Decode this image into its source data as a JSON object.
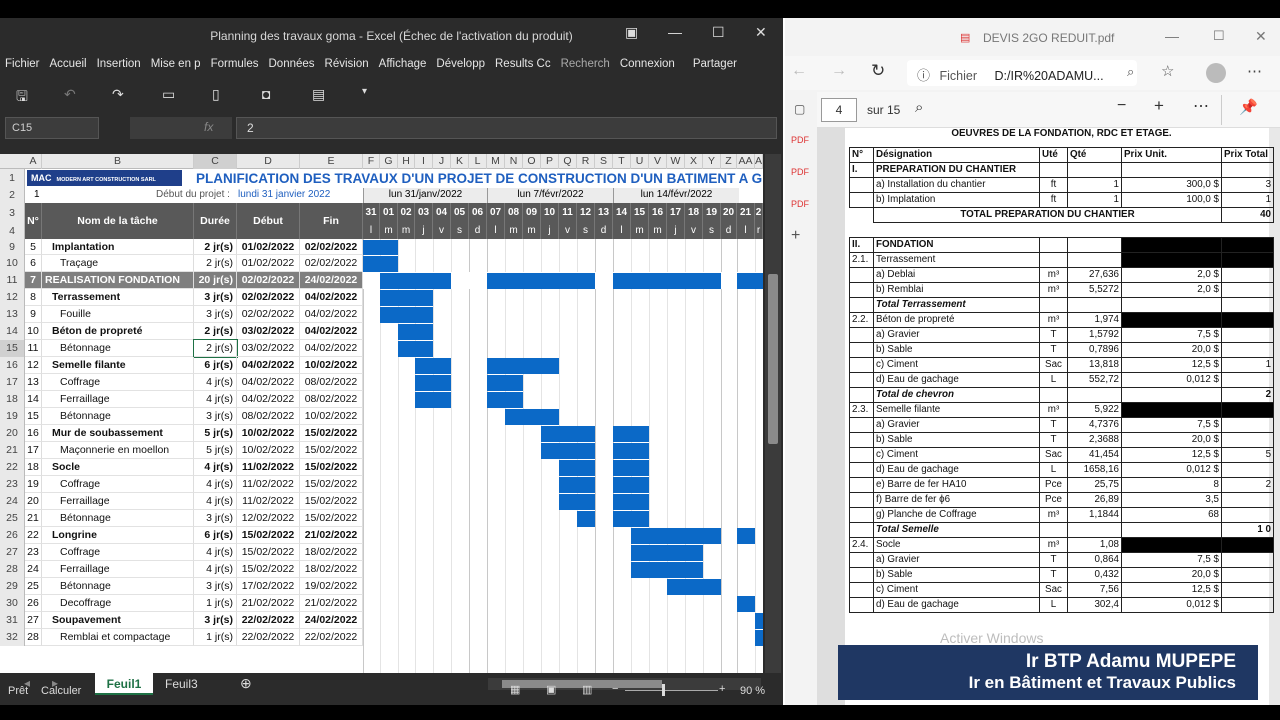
{
  "excel": {
    "title": "Planning des travaux goma - Excel (Échec de l'activation du produit)",
    "menu": [
      "Fichier",
      "Accueil",
      "Insertion",
      "Mise en p",
      "Formules",
      "Données",
      "Révision",
      "Affichage",
      "Développ",
      "Results Cc",
      "Recherch",
      "Connexion",
      "Partager"
    ],
    "namebox": "C15",
    "fx": "fx",
    "formula": "2",
    "columns": [
      "A",
      "B",
      "C",
      "D",
      "E",
      "F",
      "G",
      "H",
      "I",
      "J",
      "K",
      "L",
      "M",
      "N",
      "O",
      "P",
      "Q",
      "R",
      "S",
      "T",
      "U",
      "V",
      "W",
      "X",
      "Y",
      "Z",
      "AA",
      "A"
    ],
    "logo": "MAC MODERN ART CONSTRUCTION SARL",
    "logo_letters": "MAC",
    "logo_sub": "MODERN ART CONSTRUCTION SARL",
    "sheet_title": "PLANIFICATION DES TRAVAUX D'UN PROJET DE CONSTRUCTION D'UN BATIMENT A G",
    "row2_a": "1",
    "debut_label": "Début du projet :",
    "debut_value": "lundi 31 janvier 2022",
    "weeks": [
      "lun 31/janv/2022",
      "lun 7/févr/2022",
      "lun 14/févr/2022"
    ],
    "headers": {
      "n": "N°",
      "name": "Nom de la tâche",
      "duree": "Durée",
      "debut": "Début",
      "fin": "Fin"
    },
    "day_numbers": [
      "31",
      "01",
      "02",
      "03",
      "04",
      "05",
      "06",
      "07",
      "08",
      "09",
      "10",
      "11",
      "12",
      "13",
      "14",
      "15",
      "16",
      "17",
      "18",
      "19",
      "20",
      "21",
      "2"
    ],
    "day_letters": [
      "l",
      "m",
      "m",
      "j",
      "v",
      "s",
      "d",
      "l",
      "m",
      "m",
      "j",
      "v",
      "s",
      "d",
      "l",
      "m",
      "m",
      "j",
      "v",
      "s",
      "d",
      "l",
      "r"
    ],
    "row_numbers": [
      "1",
      "2",
      "3",
      "4",
      "9",
      "10",
      "11",
      "12",
      "13",
      "14",
      "15",
      "16",
      "17",
      "18",
      "19",
      "20",
      "21",
      "22",
      "23",
      "24",
      "25",
      "26",
      "27",
      "28",
      "29",
      "30",
      "31",
      "32"
    ],
    "rows": [
      {
        "n": "5",
        "name": "Implantation",
        "bold": true,
        "indent": 0,
        "duree": "2 jr(s)",
        "debut": "01/02/2022",
        "fin": "02/02/2022",
        "bars": [
          [
            0,
            2
          ]
        ]
      },
      {
        "n": "6",
        "name": "Traçage",
        "bold": false,
        "indent": 1,
        "duree": "2 jr(s)",
        "debut": "01/02/2022",
        "fin": "02/02/2022",
        "bars": [
          [
            0,
            2
          ]
        ]
      },
      {
        "n": "7",
        "name": "REALISATION FONDATION",
        "bold": true,
        "group": true,
        "duree": "20 jr(s)",
        "debut": "02/02/2022",
        "fin": "24/02/2022",
        "bars": [
          [
            1,
            5
          ],
          [
            7,
            13
          ],
          [
            14,
            20
          ],
          [
            21,
            23
          ]
        ]
      },
      {
        "n": "8",
        "name": "Terrassement",
        "bold": true,
        "indent": 0,
        "duree": "3 jr(s)",
        "debut": "02/02/2022",
        "fin": "04/02/2022",
        "bars": [
          [
            1,
            4
          ]
        ]
      },
      {
        "n": "9",
        "name": "Fouille",
        "bold": false,
        "indent": 1,
        "duree": "3 jr(s)",
        "debut": "02/02/2022",
        "fin": "04/02/2022",
        "bars": [
          [
            1,
            4
          ]
        ]
      },
      {
        "n": "10",
        "name": "Béton de propreté",
        "bold": true,
        "indent": 0,
        "duree": "2 jr(s)",
        "debut": "03/02/2022",
        "fin": "04/02/2022",
        "bars": [
          [
            2,
            4
          ]
        ]
      },
      {
        "n": "11",
        "name": "Bétonnage",
        "bold": false,
        "indent": 1,
        "duree": "2 jr(s)",
        "debut": "03/02/2022",
        "fin": "04/02/2022",
        "bars": [
          [
            2,
            4
          ]
        ]
      },
      {
        "n": "12",
        "name": "Semelle filante",
        "bold": true,
        "indent": 0,
        "duree": "6 jr(s)",
        "debut": "04/02/2022",
        "fin": "10/02/2022",
        "bars": [
          [
            3,
            5
          ],
          [
            7,
            11
          ]
        ]
      },
      {
        "n": "13",
        "name": "Coffrage",
        "bold": false,
        "indent": 1,
        "duree": "4 jr(s)",
        "debut": "04/02/2022",
        "fin": "08/02/2022",
        "bars": [
          [
            3,
            5
          ],
          [
            7,
            9
          ]
        ]
      },
      {
        "n": "14",
        "name": "Ferraillage",
        "bold": false,
        "indent": 1,
        "duree": "4 jr(s)",
        "debut": "04/02/2022",
        "fin": "08/02/2022",
        "bars": [
          [
            3,
            5
          ],
          [
            7,
            9
          ]
        ]
      },
      {
        "n": "15",
        "name": "Bétonnage",
        "bold": false,
        "indent": 1,
        "duree": "3 jr(s)",
        "debut": "08/02/2022",
        "fin": "10/02/2022",
        "bars": [
          [
            8,
            11
          ]
        ]
      },
      {
        "n": "16",
        "name": "Mur de soubassement",
        "bold": true,
        "indent": 0,
        "duree": "5 jr(s)",
        "debut": "10/02/2022",
        "fin": "15/02/2022",
        "bars": [
          [
            10,
            13
          ],
          [
            14,
            16
          ]
        ]
      },
      {
        "n": "17",
        "name": "Maçonnerie en moellon",
        "bold": false,
        "indent": 1,
        "duree": "5 jr(s)",
        "debut": "10/02/2022",
        "fin": "15/02/2022",
        "bars": [
          [
            10,
            13
          ],
          [
            14,
            16
          ]
        ]
      },
      {
        "n": "18",
        "name": "Socle",
        "bold": true,
        "indent": 0,
        "duree": "4 jr(s)",
        "debut": "11/02/2022",
        "fin": "15/02/2022",
        "bars": [
          [
            11,
            13
          ],
          [
            14,
            16
          ]
        ]
      },
      {
        "n": "19",
        "name": "Coffrage",
        "bold": false,
        "indent": 1,
        "duree": "4 jr(s)",
        "debut": "11/02/2022",
        "fin": "15/02/2022",
        "bars": [
          [
            11,
            13
          ],
          [
            14,
            16
          ]
        ]
      },
      {
        "n": "20",
        "name": "Ferraillage",
        "bold": false,
        "indent": 1,
        "duree": "4 jr(s)",
        "debut": "11/02/2022",
        "fin": "15/02/2022",
        "bars": [
          [
            11,
            13
          ],
          [
            14,
            16
          ]
        ]
      },
      {
        "n": "21",
        "name": "Bétonnage",
        "bold": false,
        "indent": 1,
        "duree": "3 jr(s)",
        "debut": "12/02/2022",
        "fin": "15/02/2022",
        "bars": [
          [
            12,
            13
          ],
          [
            14,
            16
          ]
        ]
      },
      {
        "n": "22",
        "name": "Longrine",
        "bold": true,
        "indent": 0,
        "duree": "6 jr(s)",
        "debut": "15/02/2022",
        "fin": "21/02/2022",
        "bars": [
          [
            15,
            20
          ],
          [
            21,
            22
          ]
        ]
      },
      {
        "n": "23",
        "name": "Coffrage",
        "bold": false,
        "indent": 1,
        "duree": "4 jr(s)",
        "debut": "15/02/2022",
        "fin": "18/02/2022",
        "bars": [
          [
            15,
            19
          ]
        ]
      },
      {
        "n": "24",
        "name": "Ferraillage",
        "bold": false,
        "indent": 1,
        "duree": "4 jr(s)",
        "debut": "15/02/2022",
        "fin": "18/02/2022",
        "bars": [
          [
            15,
            19
          ]
        ]
      },
      {
        "n": "25",
        "name": "Bétonnage",
        "bold": false,
        "indent": 1,
        "duree": "3 jr(s)",
        "debut": "17/02/2022",
        "fin": "19/02/2022",
        "bars": [
          [
            17,
            20
          ]
        ]
      },
      {
        "n": "26",
        "name": "Decoffrage",
        "bold": false,
        "indent": 1,
        "duree": "1 jr(s)",
        "debut": "21/02/2022",
        "fin": "21/02/2022",
        "bars": [
          [
            21,
            22
          ]
        ]
      },
      {
        "n": "27",
        "name": "Soupavement",
        "bold": true,
        "indent": 0,
        "duree": "3 jr(s)",
        "debut": "22/02/2022",
        "fin": "24/02/2022",
        "bars": [
          [
            22,
            23
          ]
        ]
      },
      {
        "n": "28",
        "name": "Remblai et compactage",
        "bold": false,
        "indent": 1,
        "duree": "1 jr(s)",
        "debut": "22/02/2022",
        "fin": "22/02/2022",
        "bars": [
          [
            22,
            23
          ]
        ]
      }
    ],
    "sheet_tabs": [
      "Feuil1",
      "Feuil3"
    ],
    "status_left": [
      "Prêt",
      "Calculer"
    ],
    "zoom": "90 %"
  },
  "pdf": {
    "tab_title": "DEVIS 2GO REDUIT.pdf",
    "address_label": "Fichier",
    "address": "D:/IR%20ADAMU...",
    "page": "4",
    "page_total": "sur 15",
    "heading": "OEUVRES DE LA FONDATION, RDC ET ETAGE.",
    "headers": [
      "N°",
      "Désignation",
      "Uté",
      "Qté",
      "Prix Unit.",
      "Prix Total"
    ],
    "rows": [
      {
        "n": "I.",
        "d": "PREPARATION DU CHANTIER",
        "u": "",
        "q": "",
        "p": "",
        "t": "",
        "bold": true
      },
      {
        "n": "",
        "d": "a) Installation du chantier",
        "u": "ft",
        "q": "1",
        "p": "300,0 $",
        "t": "3"
      },
      {
        "n": "",
        "d": "b) Implatation",
        "u": "ft",
        "q": "1",
        "p": "100,0 $",
        "t": "1"
      },
      {
        "n": "",
        "d": "TOTAL PREPARATION DU CHANTIER",
        "u": "",
        "q": "",
        "p": "",
        "t": "40",
        "total": true
      },
      {
        "n": "",
        "d": "",
        "u": "",
        "q": "",
        "p": "",
        "t": ""
      },
      {
        "n": "II.",
        "d": "FONDATION",
        "u": "",
        "q": "",
        "p": "",
        "t": "",
        "bold": true,
        "black": true
      },
      {
        "n": "2.1.",
        "d": "Terrassement",
        "u": "",
        "q": "",
        "p": "",
        "t": "",
        "black": true
      },
      {
        "n": "",
        "d": "a) Deblai",
        "u": "m³",
        "q": "27,636",
        "p": "2,0 $",
        "t": ""
      },
      {
        "n": "",
        "d": "b) Remblai",
        "u": "m³",
        "q": "5,5272",
        "p": "2,0 $",
        "t": ""
      },
      {
        "n": "",
        "d": "Total Terrassement",
        "u": "",
        "q": "",
        "p": "",
        "t": "",
        "italic": true
      },
      {
        "n": "2.2.",
        "d": "Béton de propreté",
        "u": "m³",
        "q": "1,974",
        "p": "",
        "t": "",
        "black": true
      },
      {
        "n": "",
        "d": "a) Gravier",
        "u": "T",
        "q": "1,5792",
        "p": "7,5 $",
        "t": ""
      },
      {
        "n": "",
        "d": "b) Sable",
        "u": "T",
        "q": "0,7896",
        "p": "20,0 $",
        "t": ""
      },
      {
        "n": "",
        "d": "c) Ciment",
        "u": "Sac",
        "q": "13,818",
        "p": "12,5 $",
        "t": "1"
      },
      {
        "n": "",
        "d": "d) Eau de gachage",
        "u": "L",
        "q": "552,72",
        "p": "0,012 $",
        "t": ""
      },
      {
        "n": "",
        "d": "Total de chevron",
        "u": "",
        "q": "",
        "p": "",
        "t": "2",
        "italic": true
      },
      {
        "n": "2.3.",
        "d": "Semelle filante",
        "u": "m³",
        "q": "5,922",
        "p": "",
        "t": "",
        "black": true
      },
      {
        "n": "",
        "d": "a) Gravier",
        "u": "T",
        "q": "4,7376",
        "p": "7,5 $",
        "t": ""
      },
      {
        "n": "",
        "d": "b) Sable",
        "u": "T",
        "q": "2,3688",
        "p": "20,0 $",
        "t": ""
      },
      {
        "n": "",
        "d": "c) Ciment",
        "u": "Sac",
        "q": "41,454",
        "p": "12,5 $",
        "t": "5"
      },
      {
        "n": "",
        "d": "d) Eau de gachage",
        "u": "L",
        "q": "1658,16",
        "p": "0,012 $",
        "t": ""
      },
      {
        "n": "",
        "d": "e) Barre de fer HA10",
        "u": "Pce",
        "q": "25,75",
        "p": "8",
        "t": "2"
      },
      {
        "n": "",
        "d": "f) Barre de fer ϕ6",
        "u": "Pce",
        "q": "26,89",
        "p": "3,5",
        "t": ""
      },
      {
        "n": "",
        "d": "g) Planche de Coffrage",
        "u": "m³",
        "q": "1,1844",
        "p": "68",
        "t": ""
      },
      {
        "n": "",
        "d": "Total Semelle",
        "u": "",
        "q": "",
        "p": "",
        "t": "1 0",
        "italic": true
      },
      {
        "n": "2.4.",
        "d": "Socle",
        "u": "m³",
        "q": "1,08",
        "p": "",
        "t": "",
        "black": true
      },
      {
        "n": "",
        "d": "a) Gravier",
        "u": "T",
        "q": "0,864",
        "p": "7,5 $",
        "t": ""
      },
      {
        "n": "",
        "d": "b) Sable",
        "u": "T",
        "q": "0,432",
        "p": "20,0 $",
        "t": ""
      },
      {
        "n": "",
        "d": "c) Ciment",
        "u": "Sac",
        "q": "7,56",
        "p": "12,5 $",
        "t": ""
      },
      {
        "n": "",
        "d": "d) Eau de gachage",
        "u": "L",
        "q": "302,4",
        "p": "0,012 $",
        "t": ""
      }
    ],
    "watermark": "Activer Windows"
  },
  "overlay": {
    "line1": "Ir BTP Adamu MUPEPE",
    "line2": "Ir en Bâtiment et Travaux Publics"
  },
  "colors": {
    "bar": "#0b69c7",
    "header": "#595959",
    "title_blue": "#1f5fbf",
    "overlay": "#1f3763"
  }
}
